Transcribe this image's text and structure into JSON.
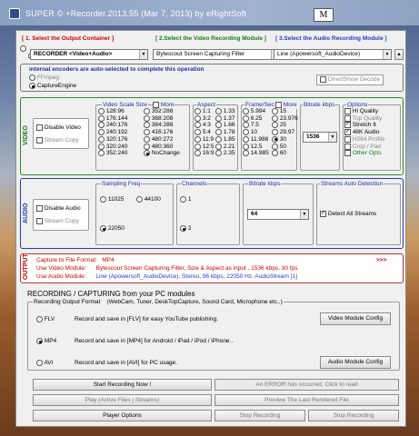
{
  "window": {
    "title": "SUPER ©   +Recorder.2013.55 (Mar 7, 2013) by eRightSoft",
    "menu_button": "M"
  },
  "steps": {
    "s1": "[ 1.       Select the Output Container ]",
    "s2": "[ 2.Select the Video Recording Module ]",
    "s3": "[ 3.Select the Audio Recording Module ]"
  },
  "selectors": {
    "container": "RECORDER <Video+Audio>",
    "video_module": "Bytescout Screen Capturing Filter",
    "audio_module": "Line (Apowersoft_AudioDevice)"
  },
  "encoders": {
    "note": "internal encoders are auto-selected to complete this operation",
    "ffmpeg": "FFmpeg",
    "capture_engine": "CaptureEngine",
    "directshow": "DirectShow Decode"
  },
  "video": {
    "section_label": "VIDEO",
    "disable": "Disable Video",
    "stream_copy": "Stream Copy",
    "scale_title": "Video Scale Size",
    "more": "More",
    "scale_col1": [
      "128:96",
      "176:144",
      "240:176",
      "240:192",
      "320:176",
      "320:240",
      "352:240"
    ],
    "scale_col2": [
      "352:288",
      "368:208",
      "384:288",
      "416:176",
      "480:272",
      "480:360",
      "NoChange"
    ],
    "aspect_title": "Aspect",
    "aspect_col1": [
      "1:1",
      "3:2",
      "4:3",
      "5:4",
      "11:9",
      "12:5",
      "16:9"
    ],
    "aspect_col2": [
      "1.33",
      "1.37",
      "1.66",
      "1.78",
      "1.85",
      "2.21",
      "2.35"
    ],
    "fps_title": "Frame/Sec",
    "fps_col1": [
      "5.994",
      "6.25",
      "7.5",
      "10",
      "11.988",
      "12.5",
      "14.985"
    ],
    "fps_col2": [
      "15",
      "23.976",
      "25",
      "29.97",
      "30",
      "50",
      "60"
    ],
    "bitrate_title": "Bitrate  kbps",
    "bitrate_value": "1536",
    "options_title": "Options",
    "options": [
      "Hi Quality",
      "Top Quality",
      "Stretch It",
      "48K Audio",
      "H264 Profile",
      "Crop / Pad",
      "Other Opts"
    ]
  },
  "audio": {
    "section_label": "AUDIO",
    "disable": "Disable Audio",
    "stream_copy": "Stream Copy",
    "freq_title": "Sampling Freq",
    "freqs": [
      "11025",
      "44100",
      "22050"
    ],
    "channels_title": "Channels",
    "channels": [
      "1",
      "2"
    ],
    "bitrate_title": "Bitrate  kbps",
    "bitrate_value": "64",
    "streams_title": "Streams Auto Detection",
    "detect_all": "Detect All Streams"
  },
  "output": {
    "section_label": "OUTPUT",
    "l1_key": "Capture to File Format:",
    "l1_val": "MP4",
    "more": ">>>",
    "l2_key": "Use Video Module:",
    "l2_val": "Bytescout Screen Capturing Filter,  Size & Aspect as input ,  1536 kbps,  30 fps",
    "l3_key": "Use Audio Module:",
    "l3_val": "Line (Apowersoft_AudioDevice),  Stereo,  96 kbps,  22050 Hz,  AudioStream [1]"
  },
  "recording": {
    "title": "RECORDING / CAPTURING from your PC modules",
    "format_title": "Recording Output Format",
    "format_hint": "(WebCam, Tuner, DeskTopCapture, Sound Card, Microphone  etc..)",
    "flv": "FLV",
    "flv_desc": "Record and save in  [FLV]  for easy YouTube publishing.",
    "mp4": "MP4",
    "mp4_desc": "Record and save in  [MP4]  for Android / iPad / iPod / iPhone..",
    "avi": "AVI",
    "avi_desc": "Record and save in  [AVI]  for PC usage.",
    "video_cfg": "Video Module Config",
    "audio_cfg": "Audio Module Config"
  },
  "buttons": {
    "start": "Start Recording Now !",
    "error": "An ERROR has occurred. Click to read",
    "play": "Play (Active Files | Streams)",
    "preview": "Preview  The Last Rendered File",
    "player_options": "Player Options",
    "stop1": "Stop Recording",
    "stop2": "Stop Recording"
  }
}
